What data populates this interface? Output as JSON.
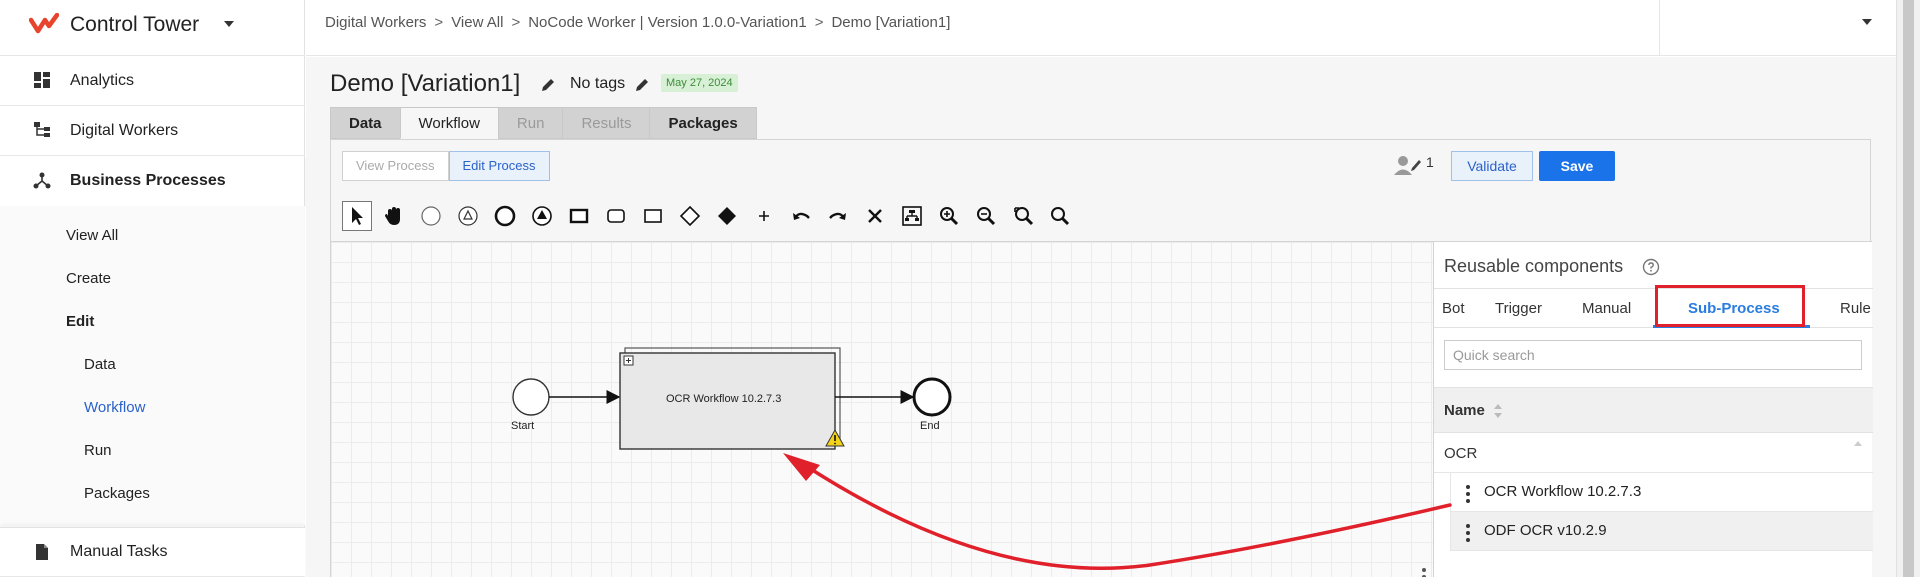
{
  "app": {
    "title": "Control Tower"
  },
  "sidebar": {
    "items": [
      {
        "label": "Analytics",
        "icon": "dashboard-icon"
      },
      {
        "label": "Digital Workers",
        "icon": "hierarchy-icon"
      },
      {
        "label": "Business Processes",
        "icon": "process-icon"
      }
    ],
    "sub_items": {
      "view_all": "View All",
      "create": "Create",
      "edit": "Edit",
      "data": "Data",
      "workflow": "Workflow",
      "run": "Run",
      "packages": "Packages"
    },
    "manual_tasks": "Manual Tasks"
  },
  "breadcrumb": [
    "Digital Workers",
    "View All",
    "NoCode Worker | Version 1.0.0-Variation1",
    "Demo [Variation1]"
  ],
  "breadcrumb_separator": ">",
  "page": {
    "title": "Demo [Variation1]",
    "tags": "No tags",
    "date": "May 27, 2024"
  },
  "tabs": {
    "data": "Data",
    "workflow": "Workflow",
    "run": "Run",
    "results": "Results",
    "packages": "Packages"
  },
  "toolbar": {
    "view_process": "View Process",
    "edit_process": "Edit Process",
    "users_count": "1",
    "validate": "Validate",
    "save": "Save"
  },
  "palette": [
    "pointer-icon",
    "hand-icon",
    "start-event-icon",
    "intermediate-event-icon",
    "end-event-icon",
    "signal-event-icon",
    "task-icon",
    "subprocess-icon",
    "transaction-icon",
    "gateway-icon",
    "exclusive-gateway-icon",
    "plus-icon",
    "undo-icon",
    "redo-icon",
    "delete-icon",
    "auto-layout-icon",
    "zoom-in-icon",
    "zoom-out-icon",
    "zoom-fit-icon",
    "zoom-reset-icon"
  ],
  "diagram": {
    "start_label": "Start",
    "task_label": "OCR Workflow 10.2.7.3",
    "end_label": "End"
  },
  "components_panel": {
    "title": "Reusable components",
    "tabs": {
      "bot": "Bot",
      "trigger": "Trigger",
      "manual": "Manual",
      "sub_process": "Sub-Process",
      "rule": "Rule"
    },
    "search_placeholder": "Quick search",
    "column_name": "Name",
    "group": "OCR",
    "rows": [
      "OCR Workflow 10.2.7.3",
      "ODF OCR v10.2.9"
    ]
  },
  "colors": {
    "accent": "#1a73e8",
    "annotation": "#e0202a",
    "logo": "#e8432c",
    "date_badge_bg": "#d8f0d6"
  }
}
